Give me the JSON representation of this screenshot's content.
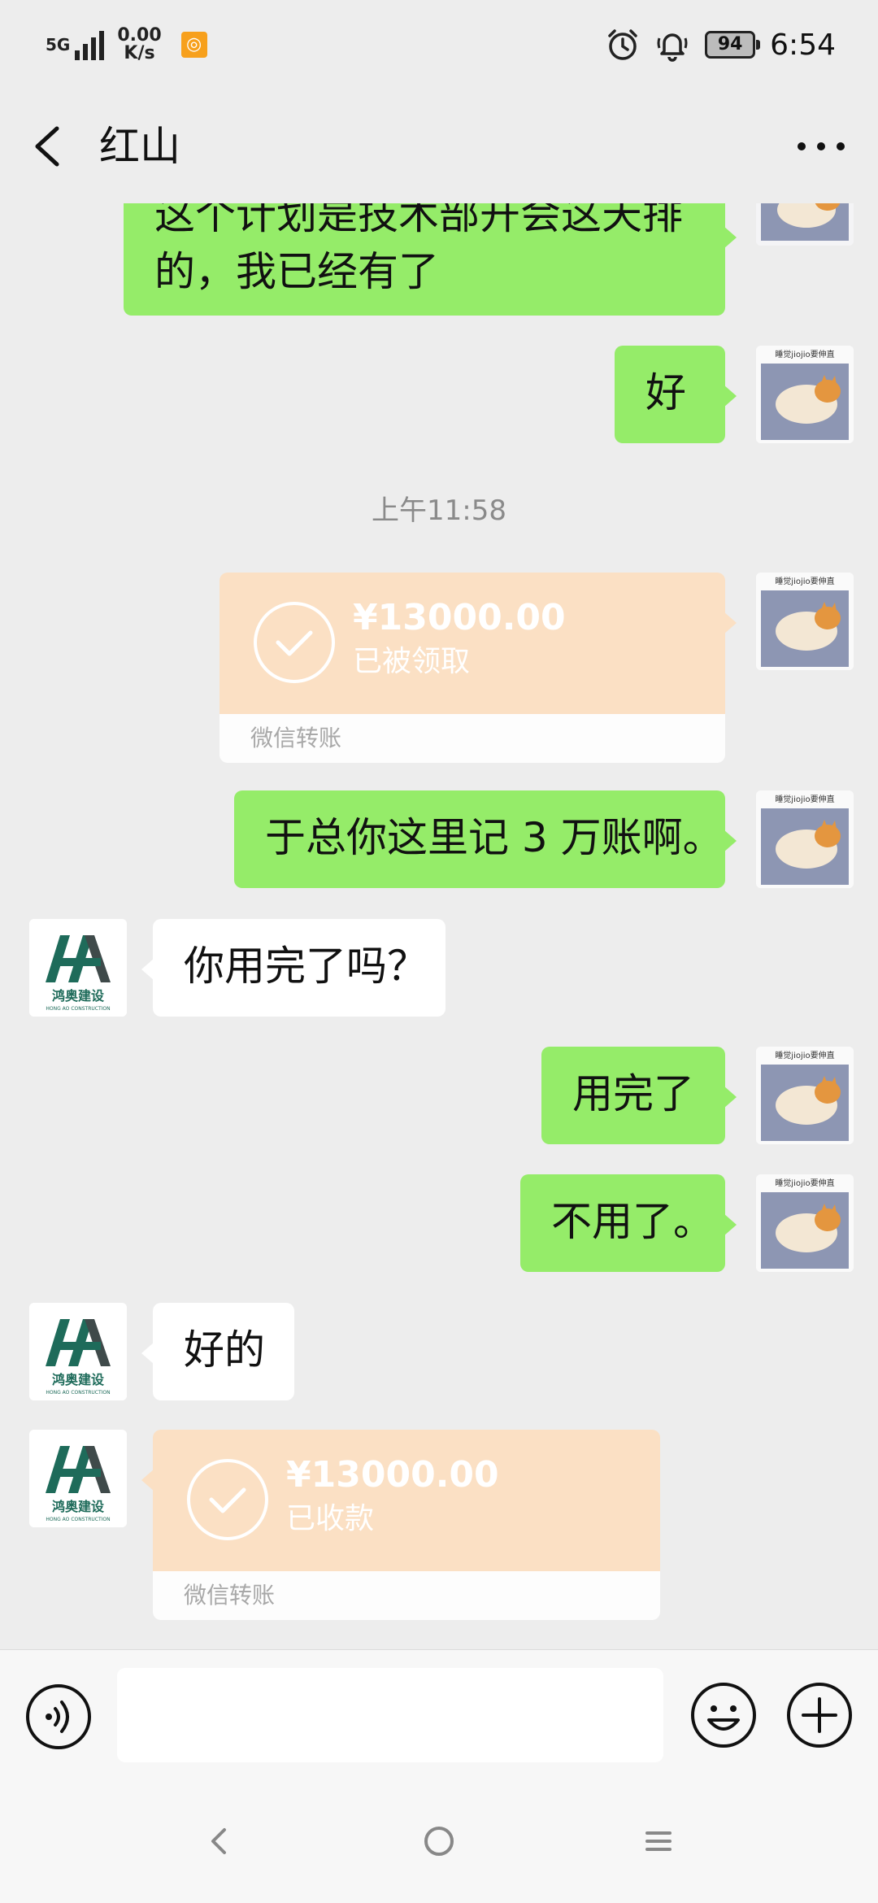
{
  "status_bar": {
    "network": "5G",
    "speed_value": "0.00",
    "speed_unit": "K/s",
    "battery": "94",
    "time": "6:54"
  },
  "header": {
    "title": "红山"
  },
  "messages": {
    "m1_line1": "这个计划是技术部开会这天排",
    "m1_line2": "的，我已经有了",
    "m2": "好",
    "time_divider": "上午11:58",
    "transfer1": {
      "amount": "¥13000.00",
      "status": "已被领取",
      "label": "微信转账"
    },
    "m4": "于总你这里记 3 万账啊。",
    "m5": "你用完了吗？",
    "m6": "用完了",
    "m7": "不用了。",
    "m8": "好的",
    "transfer2": {
      "amount": "¥13000.00",
      "status": "已收款",
      "label": "微信转账"
    }
  },
  "avatars": {
    "self_caption": "睡觉jiojio要伸直",
    "company_brand": "鸿奥建设",
    "company_sub": "HONG AO CONSTRUCTION"
  },
  "input_bar": {
    "placeholder": ""
  },
  "colors": {
    "self_bubble": "#95ec69",
    "other_bubble": "#ffffff",
    "transfer_card": "#fbe0c4",
    "background": "#ededed"
  },
  "icons": [
    "back-icon",
    "more-icon",
    "voice-icon",
    "emoji-icon",
    "plus-icon",
    "nav-back-icon",
    "nav-home-icon",
    "nav-menu-icon",
    "check-icon",
    "alarm-icon",
    "bell-icon"
  ]
}
